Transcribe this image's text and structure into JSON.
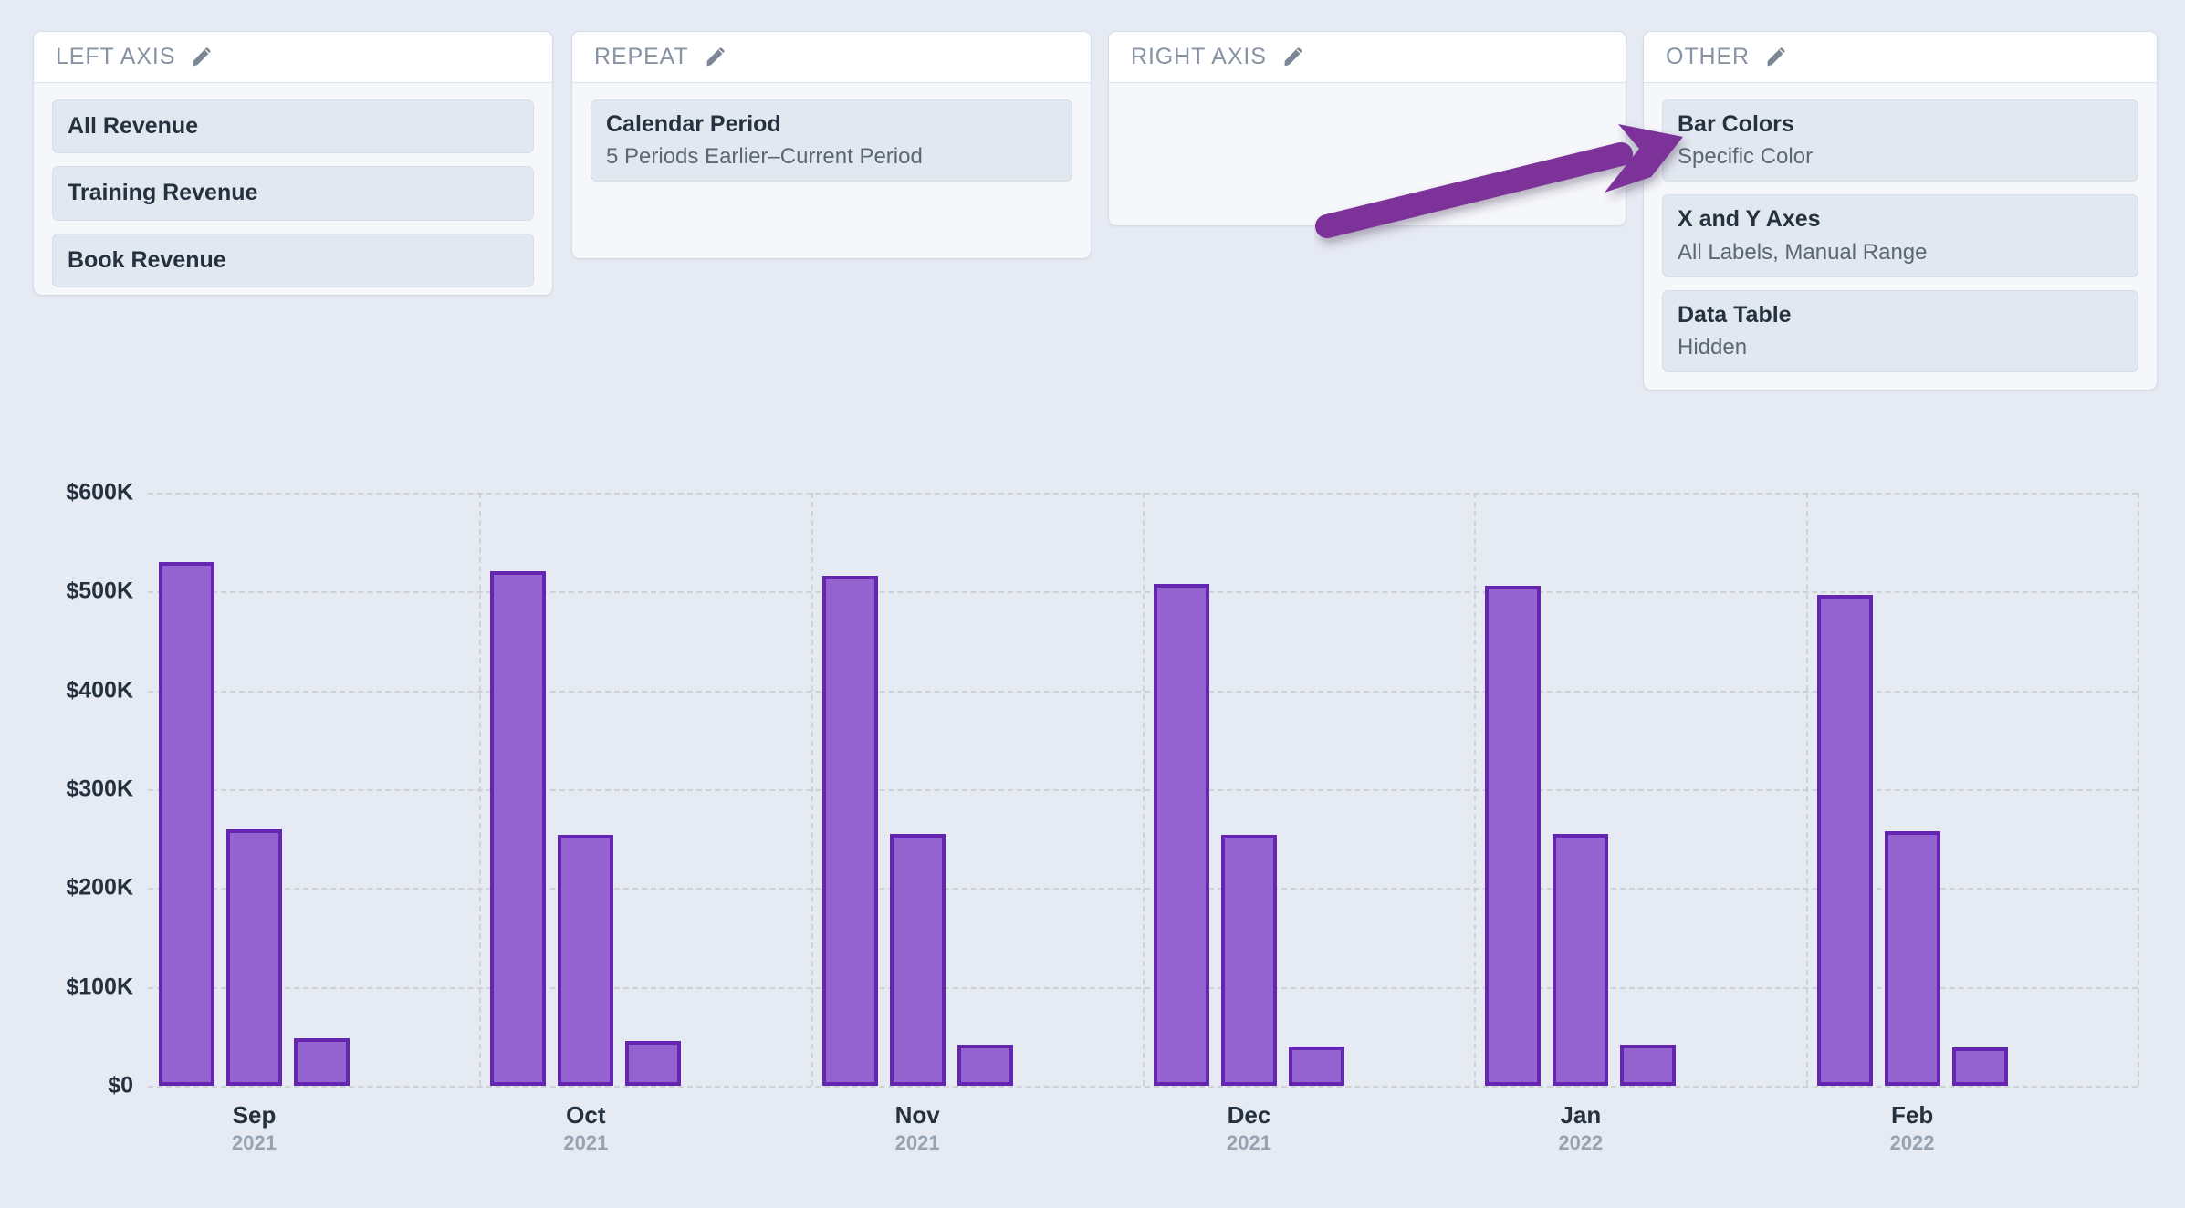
{
  "panels": [
    {
      "id": "left-axis",
      "title": "LEFT AXIS",
      "edit_icon": "pencil-icon",
      "items": [
        {
          "title": "All Revenue",
          "sub": ""
        },
        {
          "title": "Training Revenue",
          "sub": ""
        },
        {
          "title": "Book Revenue",
          "sub": ""
        }
      ]
    },
    {
      "id": "repeat",
      "title": "REPEAT",
      "edit_icon": "pencil-icon",
      "items": [
        {
          "title": "Calendar Period",
          "sub": "5 Periods Earlier–Current Period"
        }
      ]
    },
    {
      "id": "right-axis",
      "title": "RIGHT AXIS",
      "edit_icon": "pencil-icon",
      "items": []
    },
    {
      "id": "other",
      "title": "OTHER",
      "edit_icon": "pencil-icon",
      "items": [
        {
          "title": "Bar Colors",
          "sub": "Specific Color"
        },
        {
          "title": "X and Y Axes",
          "sub": "All Labels, Manual Range"
        },
        {
          "title": "Data Table",
          "sub": "Hidden"
        }
      ]
    }
  ],
  "annotation": {
    "type": "arrow",
    "points_to": "Bar Colors",
    "color": "#7b3098"
  },
  "colors": {
    "background": "#e6eaf2",
    "panel_body": "#f5f7fa",
    "panel_header": "#ffffff",
    "chip": "#e2e8ef",
    "bar_fill": "#9563cf",
    "bar_stroke": "#6425b0",
    "gridline": "#c9d0cd",
    "arrow": "#7b3098",
    "title_text": "#8793a3",
    "label_text": "#26313f",
    "muted_text": "#98a3b2"
  },
  "chart_data": {
    "type": "bar",
    "title": "",
    "xlabel": "",
    "ylabel": "",
    "ylim": [
      0,
      600000
    ],
    "ytick_labels": [
      "$600K",
      "$500K",
      "$400K",
      "$300K",
      "$200K",
      "$100K",
      "$0"
    ],
    "ytick_values": [
      600000,
      500000,
      400000,
      300000,
      200000,
      100000,
      0
    ],
    "grid": true,
    "legend": "none",
    "categories": [
      "Sep",
      "Oct",
      "Nov",
      "Dec",
      "Jan",
      "Feb"
    ],
    "category_years": [
      "2021",
      "2021",
      "2021",
      "2021",
      "2022",
      "2022"
    ],
    "series": [
      {
        "name": "All Revenue",
        "values": [
          530000,
          521000,
          516000,
          508000,
          506000,
          497000
        ]
      },
      {
        "name": "Training Revenue",
        "values": [
          259000,
          254000,
          255000,
          254000,
          255000,
          258000
        ]
      },
      {
        "name": "Book Revenue",
        "values": [
          48000,
          45000,
          42000,
          40000,
          42000,
          39000
        ]
      }
    ]
  }
}
